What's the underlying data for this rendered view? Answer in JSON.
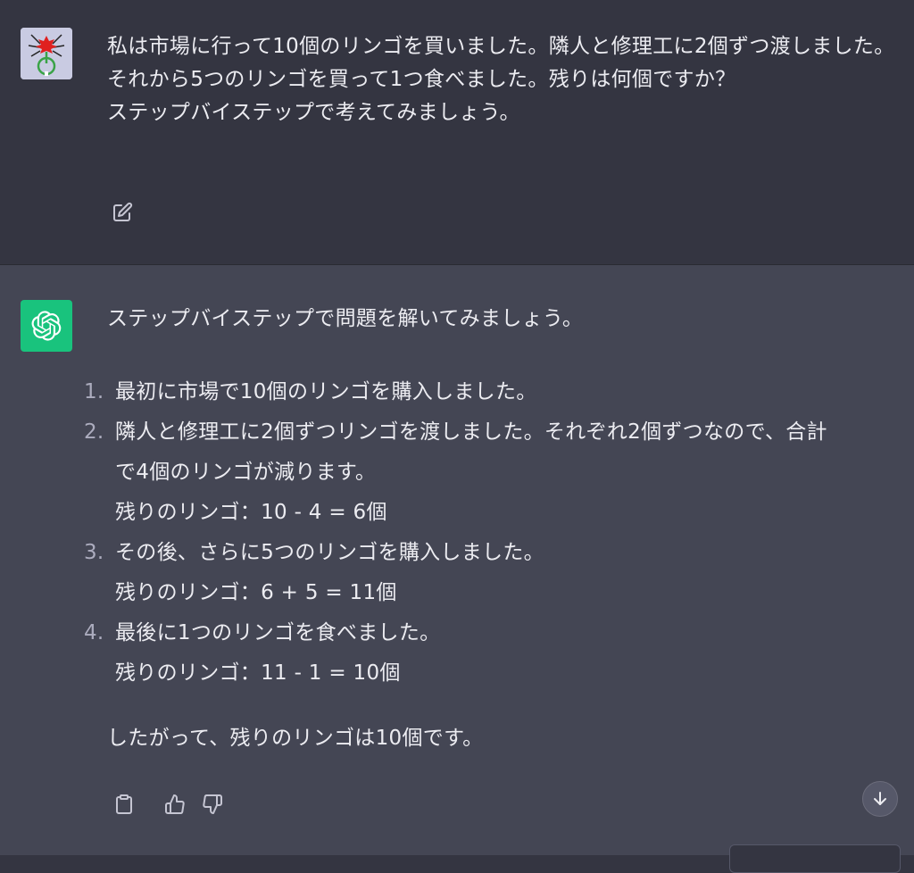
{
  "user_message": {
    "text": "私は市場に行って10個のリンゴを買いました。隣人と修理工に2個ずつ渡しました。それから5つのリンゴを買って1つ食べました。残りは何個ですか？\nステップバイステップで考えてみましょう。",
    "avatar_icon": "spider-avatar-icon",
    "edit_icon": "edit-icon"
  },
  "assistant_message": {
    "avatar_icon": "openai-logo-icon",
    "intro": "ステップバイステップで問題を解いてみましょう。",
    "steps": [
      {
        "num": "1.",
        "lines": [
          "最初に市場で10個のリンゴを購入しました。"
        ]
      },
      {
        "num": "2.",
        "lines": [
          "隣人と修理工に2個ずつリンゴを渡しました。それぞれ2個ずつなので、合計",
          "で4個のリンゴが減ります。",
          "残りのリンゴ：10 - 4 = 6個"
        ]
      },
      {
        "num": "3.",
        "lines": [
          "その後、さらに5つのリンゴを購入しました。",
          "残りのリンゴ：6 + 5 = 11個"
        ]
      },
      {
        "num": "4.",
        "lines": [
          "最後に1つのリンゴを食べました。",
          "残りのリンゴ：11 - 1 = 10個"
        ]
      }
    ],
    "conclusion": "したがって、残りのリンゴは10個です。",
    "actions": {
      "copy_icon": "clipboard-icon",
      "like_icon": "thumbs-up-icon",
      "dislike_icon": "thumbs-down-icon"
    }
  },
  "scroll_button_icon": "arrow-down-icon",
  "colors": {
    "user_bg": "#343541",
    "assistant_bg": "#444654",
    "bot_avatar_bg": "#19c37d",
    "text": "#ececf1"
  }
}
